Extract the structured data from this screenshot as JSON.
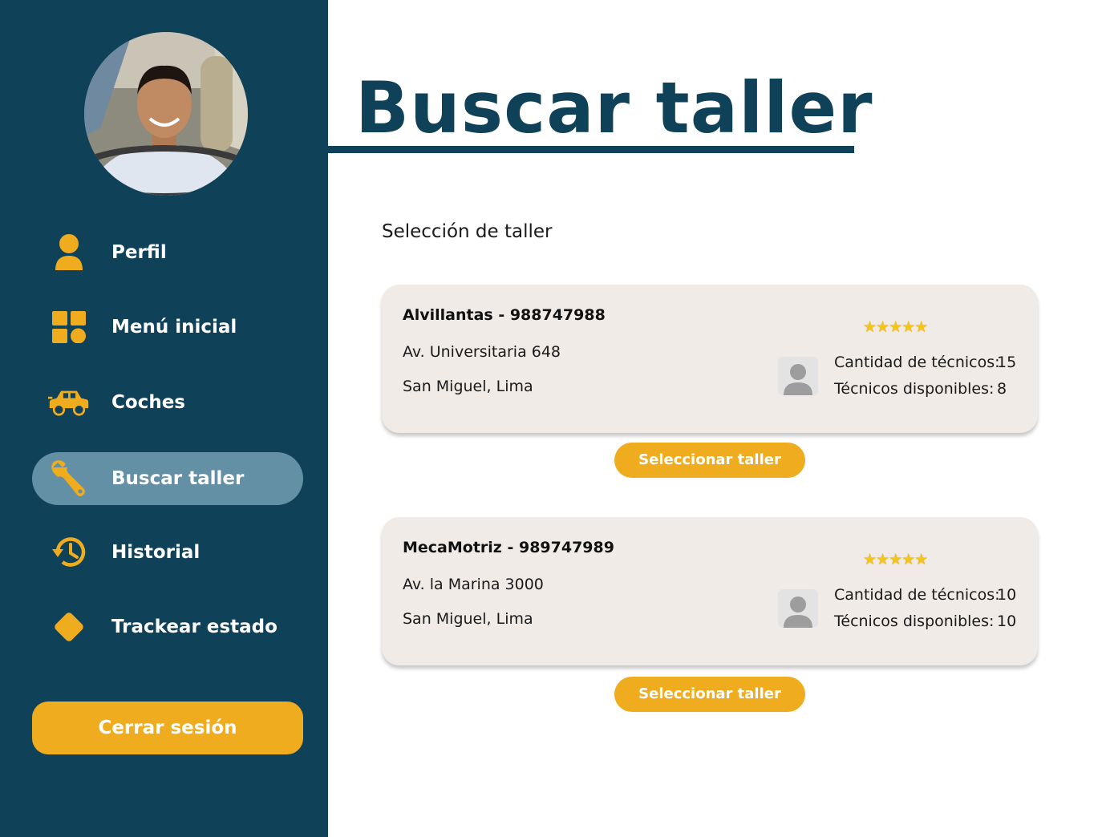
{
  "sidebar": {
    "items": [
      {
        "label": "Perfil",
        "icon": "person-icon"
      },
      {
        "label": "Menú inicial",
        "icon": "grid-icon"
      },
      {
        "label": "Coches",
        "icon": "car-icon"
      },
      {
        "label": "Buscar taller",
        "icon": "wrench-icon"
      },
      {
        "label": "Historial",
        "icon": "history-icon"
      },
      {
        "label": "Trackear estado",
        "icon": "diamond-icon"
      }
    ],
    "active_item": "Buscar taller",
    "logout_label": "Cerrar sesión"
  },
  "main": {
    "title": "Buscar taller",
    "section_label": "Selección de taller",
    "workshops": [
      {
        "name": "Alvillantas - 988747988",
        "address": "Av. Universitaria 648",
        "district": "San Miguel, Lima",
        "stars": "★★★★★",
        "rating": 5,
        "technicians_label": "Cantidad de técnicos:",
        "technicians_value": "15",
        "available_label": "Técnicos disponibles:",
        "available_value": "8",
        "button_label": "Seleccionar taller"
      },
      {
        "name": "MecaMotriz - 989747989",
        "address": "Av. la Marina 3000",
        "district": "San Miguel, Lima",
        "stars": "★★★★★",
        "rating": 5,
        "technicians_label": "Cantidad de técnicos:",
        "technicians_value": "10",
        "available_label": "Técnicos disponibles:",
        "available_value": "10",
        "button_label": "Seleccionar taller"
      }
    ]
  },
  "colors": {
    "sidebar_bg": "#0f4159",
    "accent": "#f0ac1f",
    "active_item_bg": "#6390a4",
    "card_bg": "#f0ebe7"
  }
}
